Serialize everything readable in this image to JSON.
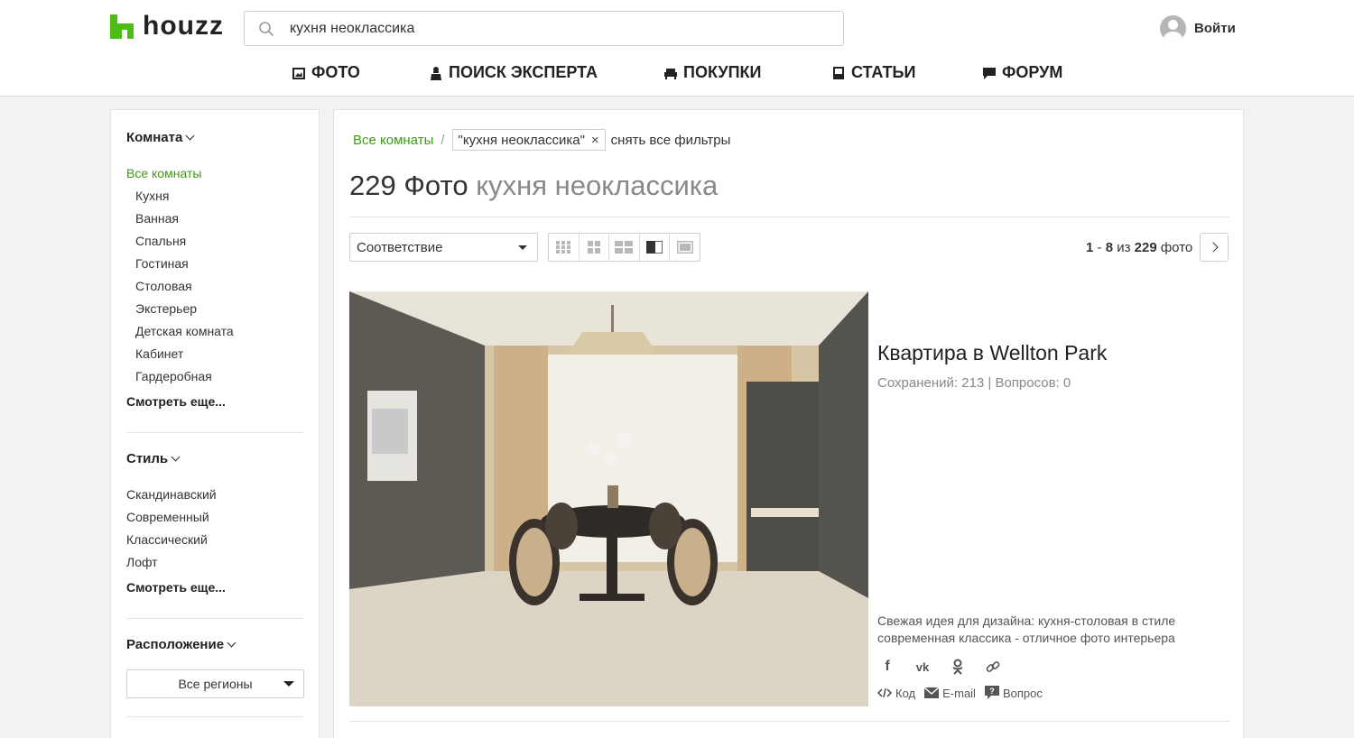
{
  "brand": {
    "logo_text": "houzz",
    "accent": "#4dbc15"
  },
  "search": {
    "value": "кухня неоклассика",
    "placeholder": ""
  },
  "login": {
    "label": "Войти"
  },
  "nav": {
    "photo": "ФОТО",
    "expert": "ПОИСК ЭКСПЕРТА",
    "shop": "ПОКУПКИ",
    "articles": "СТАТЬИ",
    "forum": "ФОРУМ"
  },
  "sidebar": {
    "room": {
      "title": "Комната",
      "all": "Все комнаты",
      "items": [
        "Кухня",
        "Ванная",
        "Спальня",
        "Гостиная",
        "Столовая",
        "Экстерьер",
        "Детская комната",
        "Кабинет",
        "Гардеробная"
      ],
      "more": "Смотреть еще..."
    },
    "style": {
      "title": "Стиль",
      "items": [
        "Скандинавский",
        "Современный",
        "Классический",
        "Лофт"
      ],
      "more": "Смотреть еще..."
    },
    "location": {
      "title": "Расположение",
      "select_value": "Все регионы"
    }
  },
  "main": {
    "breadcrumb_all": "Все комнаты",
    "breadcrumb_sep": "/",
    "filter_chip": "\"кухня неоклассика\"",
    "filter_chip_close": "×",
    "clear_filters": "снять все фильтры",
    "title_count": "229 Фото",
    "title_query": "кухня неоклассика",
    "sort_value": "Соответствие",
    "pager": {
      "from": "1",
      "dash": "-",
      "to": "8",
      "of": "из",
      "total": "229",
      "unit": "фото"
    }
  },
  "card": {
    "title": "Квартира в Wellton Park",
    "meta": "Сохранений: 213 | Вопросов: 0",
    "description": "Свежая идея для дизайна: кухня-столовая в стиле современная классика - отличное фото интерьера",
    "actions": {
      "code": "Код",
      "email": "E-mail",
      "question": "Вопрос"
    }
  }
}
